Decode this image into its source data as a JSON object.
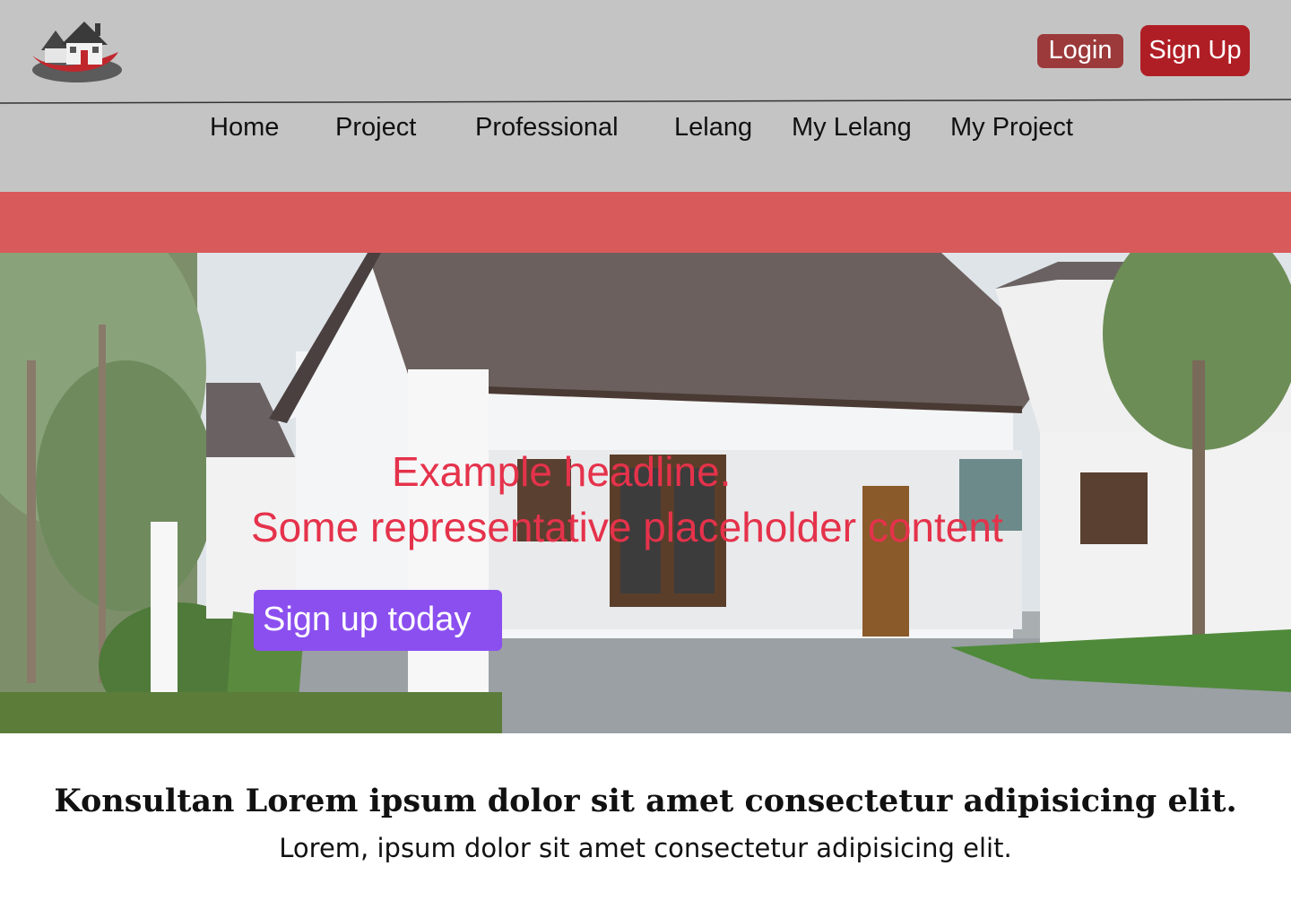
{
  "header": {
    "logo_icon": "house-logo-icon",
    "login_label": "Login",
    "signup_label": "Sign Up",
    "login_color": "#9c3a3b",
    "signup_color": "#b01e25"
  },
  "nav": {
    "items": [
      {
        "label": "Home"
      },
      {
        "label": "Project"
      },
      {
        "label": "Professional"
      },
      {
        "label": "Lelang"
      },
      {
        "label": "My Lelang"
      },
      {
        "label": "My Project"
      }
    ]
  },
  "hero": {
    "headline_line1": "Example headline.",
    "headline_line2": "Some representative placeholder content",
    "cta_label": "Sign up today",
    "headline_color": "#e5324b",
    "cta_color": "#8b4ff0",
    "band_color": "#d95a5a"
  },
  "content": {
    "title": "Konsultan Lorem ipsum dolor sit amet consectetur adipisicing elit.",
    "subtitle": "Lorem, ipsum dolor sit amet consectetur adipisicing elit."
  }
}
